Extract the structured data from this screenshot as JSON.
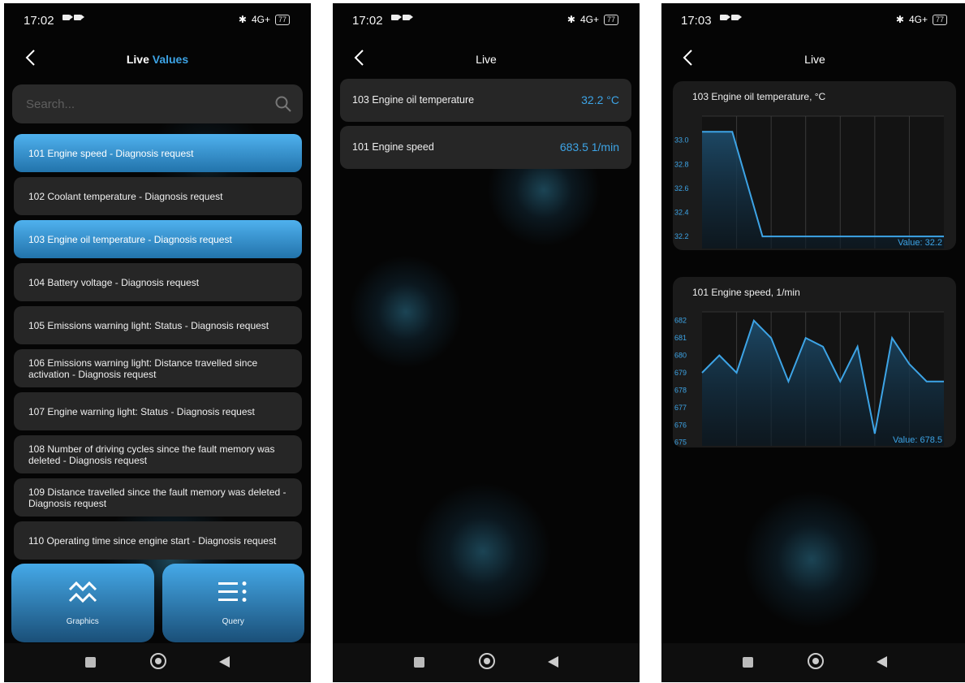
{
  "screens": [
    {
      "status": {
        "time": "17:02"
      },
      "title": {
        "part1": "Live",
        "part2": "Values"
      },
      "search": {
        "placeholder": "Search..."
      },
      "items": [
        {
          "label": "101 Engine speed - Diagnosis request",
          "selected": true
        },
        {
          "label": "102 Coolant temperature - Diagnosis request",
          "selected": false
        },
        {
          "label": "103 Engine oil temperature - Diagnosis request",
          "selected": true
        },
        {
          "label": "104 Battery voltage - Diagnosis request",
          "selected": false
        },
        {
          "label": "105 Emissions warning light: Status - Diagnosis request",
          "selected": false
        },
        {
          "label": "106 Emissions warning light: Distance travelled since activation - Diagnosis request",
          "selected": false
        },
        {
          "label": "107 Engine warning light: Status - Diagnosis request",
          "selected": false
        },
        {
          "label": "108 Number of driving cycles since the fault memory was deleted - Diagnosis request",
          "selected": false
        },
        {
          "label": "109 Distance travelled since the fault memory was deleted - Diagnosis request",
          "selected": false
        },
        {
          "label": "110 Operating time since engine start - Diagnosis request",
          "selected": false
        }
      ],
      "buttons": {
        "graphics": "Graphics",
        "query": "Query"
      }
    },
    {
      "status": {
        "time": "17:02"
      },
      "title": "Live",
      "values": [
        {
          "label": "103 Engine oil temperature",
          "value": "32.2 °C"
        },
        {
          "label": "101 Engine speed",
          "value": "683.5 1/min"
        }
      ]
    },
    {
      "status": {
        "time": "17:03"
      },
      "title": "Live"
    }
  ],
  "status_icons": {
    "network": "4G+",
    "battery": "77"
  },
  "accent_color": "#3da4e6",
  "chart_data": [
    {
      "type": "area",
      "title": "103 Engine oil temperature, °C",
      "y_ticks": [
        "33.0",
        "32.8",
        "32.6",
        "32.4",
        "32.2"
      ],
      "ylim": [
        32.1,
        33.2
      ],
      "x": [
        0,
        1,
        2,
        3,
        4,
        5,
        6,
        7,
        8
      ],
      "values": [
        33.07,
        33.07,
        32.2,
        32.2,
        32.2,
        32.2,
        32.2,
        32.2,
        32.2
      ],
      "value_label": "Value: 32.2",
      "grid": true
    },
    {
      "type": "area",
      "title": "101 Engine speed, 1/min",
      "y_ticks": [
        "682",
        "681",
        "680",
        "679",
        "678",
        "677",
        "676",
        "675"
      ],
      "ylim": [
        674.8,
        682.5
      ],
      "x": [
        0,
        1,
        2,
        3,
        4,
        5,
        6,
        7,
        8,
        9,
        10,
        11,
        12,
        13,
        14
      ],
      "values": [
        679,
        680,
        679,
        682,
        681,
        678.5,
        681,
        680.5,
        678.5,
        680.5,
        675.5,
        681,
        679.5,
        678.5,
        678.5
      ],
      "value_label": "Value: 678.5",
      "grid": true
    }
  ]
}
